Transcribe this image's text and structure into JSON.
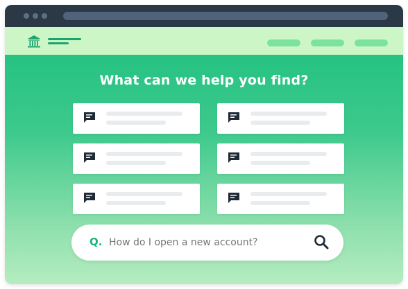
{
  "colors": {
    "titlebar": "#2b3947",
    "navbar": "#cdf6c7",
    "accent": "#17b676",
    "gradient_top": "#17be7c",
    "gradient_bottom": "#b5ecc0"
  },
  "icons": {
    "logo": "bank-icon",
    "menu": "hamburger-menu-icon",
    "card": "chat-bubble-icon",
    "search": "magnifying-glass-icon"
  },
  "main": {
    "headline": "What can we help you find?"
  },
  "search": {
    "prefix": "Q.",
    "placeholder": "How do I open a new account?"
  }
}
